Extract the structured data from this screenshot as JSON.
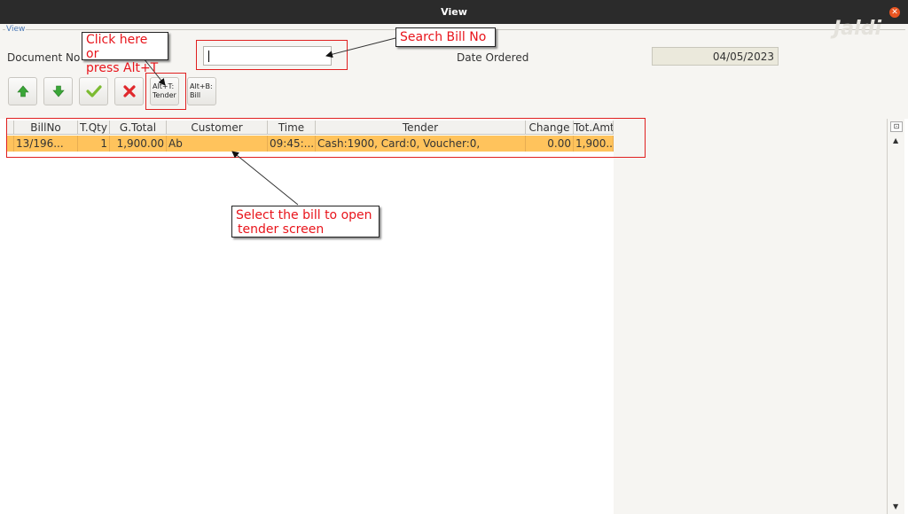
{
  "window": {
    "title": "View",
    "close_glyph": "✕"
  },
  "panel": {
    "legend": "View",
    "logo": "Jaldi"
  },
  "form": {
    "document_no_label": "Document No",
    "search_value": "",
    "date_ordered_label": "Date Ordered",
    "date_ordered_value": "04/05/2023"
  },
  "toolbar": {
    "buttons": [
      {
        "icon": "arrow-up-icon",
        "color": "#3aa637"
      },
      {
        "icon": "arrow-down-icon",
        "color": "#3aa637"
      },
      {
        "icon": "checkmark-icon",
        "color": "#7cbb32"
      },
      {
        "icon": "cross-icon",
        "color": "#e0282c"
      }
    ],
    "tender_line1": "Alt+T:",
    "tender_line2": "Tender",
    "bill_line1": "Alt+B:",
    "bill_line2": "Bill"
  },
  "table": {
    "columns": [
      "BillNo",
      "T.Qty",
      "G.Total",
      "Customer",
      "Time",
      "Tender",
      "Change",
      "Tot.Amt"
    ],
    "rows": [
      [
        "13/196...",
        "1",
        "1,900.00",
        "Ab",
        "09:45:...",
        "Cash:1900, Card:0, Voucher:0,",
        "0.00",
        "1,900...."
      ]
    ],
    "selected_row_color": "#ffc35c"
  },
  "annotations": {
    "click_here_line1": "Click here or",
    "click_here_line2": "press Alt+T",
    "search_bill": "Search Bill No",
    "select_line1": "Select the bill to open",
    "select_line2": "tender screen",
    "highlight_color": "#e02020"
  },
  "scrollbar": {
    "corner_glyph": "⊡",
    "up_glyph": "▲",
    "down_glyph": "▼"
  }
}
